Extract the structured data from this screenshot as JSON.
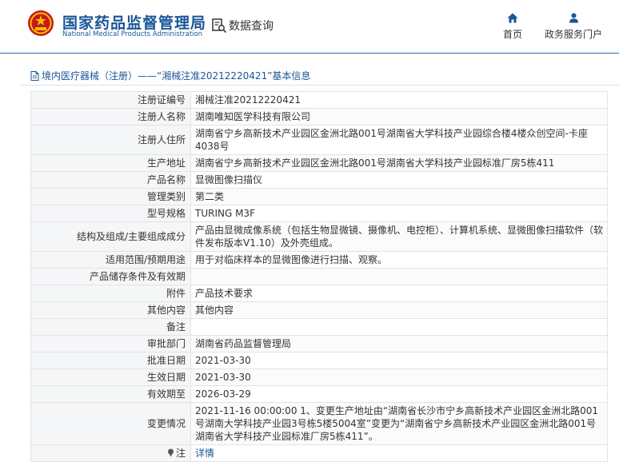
{
  "header": {
    "brand_cn": "国家药品监督管理局",
    "brand_en": "National Medical Products Administration",
    "data_query": "数据查询",
    "nav": [
      {
        "label": "首页",
        "icon": "home-icon"
      },
      {
        "label": "政务服务门户",
        "icon": "user-icon"
      }
    ]
  },
  "breadcrumb": "境内医疗器械（注册）——“湘械注准20212220421”基本信息",
  "rows": [
    {
      "key": "注册证编号",
      "value": "湘械注准20212220421"
    },
    {
      "key": "注册人名称",
      "value": "湖南唯知医学科技有限公司"
    },
    {
      "key": "注册人住所",
      "value": "湖南省宁乡高新技术产业园区金洲北路001号湖南省大学科技产业园综合楼4楼众创空间-卡座4038号"
    },
    {
      "key": "生产地址",
      "value": "湖南省宁乡高新技术产业园区金洲北路001号湖南省大学科技产业园标准厂房5栋411"
    },
    {
      "key": "产品名称",
      "value": "显微图像扫描仪"
    },
    {
      "key": "管理类别",
      "value": "第二类"
    },
    {
      "key": "型号规格",
      "value": "TURING M3F"
    },
    {
      "key": "结构及组成/主要组成成分",
      "value": "产品由显微成像系统（包括生物显微镜、摄像机、电控柜）、计算机系统、显微图像扫描软件（软件发布版本V1.10）及外壳组成。"
    },
    {
      "key": "适用范围/预期用途",
      "value": "用于对临床样本的显微图像进行扫描、观察。"
    },
    {
      "key": "产品储存条件及有效期",
      "value": ""
    },
    {
      "key": "附件",
      "value": "产品技术要求"
    },
    {
      "key": "其他内容",
      "value": "其他内容"
    },
    {
      "key": "备注",
      "value": ""
    },
    {
      "key": "审批部门",
      "value": "湖南省药品监督管理局"
    },
    {
      "key": "批准日期",
      "value": "2021-03-30"
    },
    {
      "key": "生效日期",
      "value": "2021-03-30"
    },
    {
      "key": "有效期至",
      "value": "2026-03-29"
    },
    {
      "key": "变更情况",
      "value": "2021-11-16 00:00:00 1、变更生产地址由“湖南省长沙市宁乡高新技术产业园区金洲北路001号湖南大学科技产业园3号栋5楼5004室”变更为“湖南省宁乡高新技术产业园区金洲北路001号湖南省大学科技产业园标准厂房5栋411”。"
    },
    {
      "key": "注",
      "value": "详情",
      "key_icon": "pin-icon"
    }
  ]
}
